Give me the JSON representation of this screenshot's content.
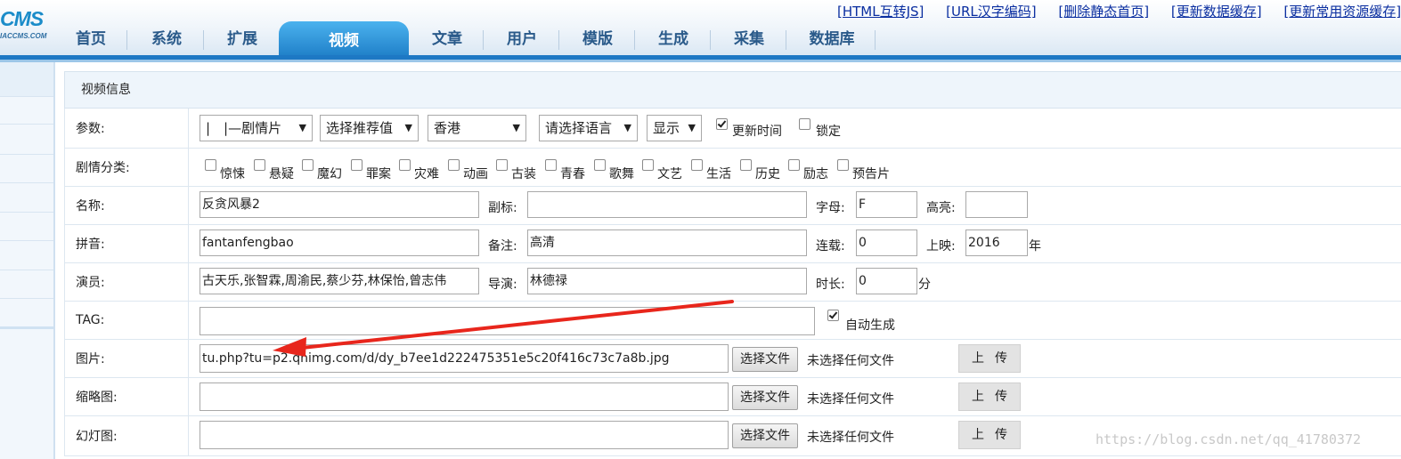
{
  "logo": {
    "main": "CMS",
    "sub": "IACCMS.COM"
  },
  "top_links": [
    "[HTML互转JS]",
    "[URL汉字编码]",
    "[删除静态首页]",
    "[更新数据缓存]",
    "[更新常用资源缓存]"
  ],
  "nav": {
    "items": [
      "首页",
      "系统",
      "扩展",
      "视频",
      "文章",
      "用户",
      "模版",
      "生成",
      "采集",
      "数据库"
    ],
    "active": "视频"
  },
  "panel": {
    "title": "视频信息"
  },
  "params": {
    "label": "参数:",
    "type_select": "|　|—剧情片",
    "recommend_select": "选择推荐值",
    "area_select": "香港",
    "lang_select": "请选择语言",
    "display_select": "显示",
    "update_time": {
      "label": "更新时间",
      "checked": true
    },
    "lock": {
      "label": "锁定",
      "checked": false
    }
  },
  "genres": {
    "label": "剧情分类:",
    "items": [
      "惊悚",
      "悬疑",
      "魔幻",
      "罪案",
      "灾难",
      "动画",
      "古装",
      "青春",
      "歌舞",
      "文艺",
      "生活",
      "历史",
      "励志",
      "预告片"
    ]
  },
  "name_row": {
    "label": "名称:",
    "name": "反贪风暴2",
    "subtitle_label": "副标:",
    "subtitle": "",
    "letter_label": "字母:",
    "letter": "F",
    "highlight_label": "高亮:",
    "highlight": ""
  },
  "pinyin_row": {
    "label": "拼音:",
    "pinyin": "fantanfengbao",
    "remark_label": "备注:",
    "remark": "高清",
    "serial_label": "连载:",
    "serial": "0",
    "year_label": "上映:",
    "year": "2016",
    "year_unit": "年"
  },
  "actor_row": {
    "label": "演员:",
    "actors": "古天乐,张智霖,周渝民,蔡少芬,林保怡,曾志伟",
    "director_label": "导演:",
    "director": "林德禄",
    "duration_label": "时长:",
    "duration": "0",
    "duration_unit": "分"
  },
  "tag_row": {
    "label": "TAG:",
    "tag": "",
    "auto": {
      "label": "自动生成",
      "checked": true
    }
  },
  "pic_row": {
    "label": "图片:",
    "value": "tu.php?tu=p2.qhimg.com/d/dy_b7ee1d222475351e5c20f416c73c7a8b.jpg",
    "choose": "选择文件",
    "no_file": "未选择任何文件",
    "upload": "上传"
  },
  "thumb_row": {
    "label": "缩略图:",
    "value": "",
    "choose": "选择文件",
    "no_file": "未选择任何文件",
    "upload": "上传"
  },
  "slide_row": {
    "label": "幻灯图:",
    "value": "",
    "choose": "选择文件",
    "no_file": "未选择任何文件",
    "upload": "上传"
  },
  "watermark": "https://blog.csdn.net/qq_41780372",
  "colors": {
    "nav_active": "#2a8fd9",
    "header_bar": "#1d78c4",
    "arrow": "#e8261c"
  }
}
